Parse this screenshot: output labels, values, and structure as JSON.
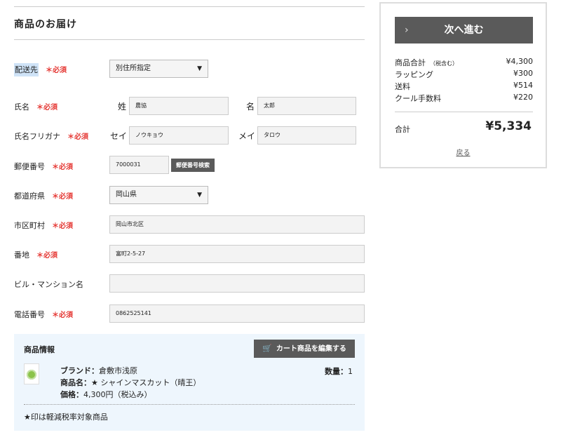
{
  "section": {
    "title": "商品のお届け"
  },
  "form": {
    "delivery": {
      "label": "配送先",
      "required": "＊必須",
      "value": "別住所指定"
    },
    "name": {
      "label": "氏名",
      "required": "＊必須",
      "sei_label": "姓",
      "sei_value": "農協",
      "mei_label": "名",
      "mei_value": "太郎"
    },
    "kana": {
      "label": "氏名フリガナ",
      "required": "＊必須",
      "sei_label": "セイ",
      "sei_value": "ノウキョウ",
      "mei_label": "メイ",
      "mei_value": "タロウ"
    },
    "zip": {
      "label": "郵便番号",
      "required": "＊必須",
      "value": "7000031",
      "button": "郵便番号検索"
    },
    "prefecture": {
      "label": "都道府県",
      "required": "＊必須",
      "value": "岡山県"
    },
    "city": {
      "label": "市区町村",
      "required": "＊必須",
      "value": "岡山市北区"
    },
    "address": {
      "label": "番地",
      "required": "＊必須",
      "value": "富町2-5-27"
    },
    "building": {
      "label": "ビル・マンション名",
      "value": ""
    },
    "phone": {
      "label": "電話番号",
      "required": "＊必須",
      "value": "0862525141"
    }
  },
  "product": {
    "title": "商品情報",
    "edit_button": "カート商品を編集する",
    "brand_label": "ブランド：",
    "brand_value": "倉敷市浅原",
    "name_label": "商品名：",
    "name_value": "★ シャインマスカット（晴王）",
    "price_label": "価格：",
    "price_value": "4,300円（税込み）",
    "qty_label": "数量：",
    "qty_value": "1",
    "note": "★印は軽減税率対象商品"
  },
  "summary": {
    "next_button": "次へ進む",
    "rows": [
      {
        "label": "商品合計",
        "sub": "（税含む）",
        "value": "¥4,300"
      },
      {
        "label": "ラッピング",
        "sub": "",
        "value": "¥300"
      },
      {
        "label": "送料",
        "sub": "",
        "value": "¥514"
      },
      {
        "label": "クール手数料",
        "sub": "",
        "value": "¥220"
      }
    ],
    "total_label": "合計",
    "total_value": "¥5,334",
    "back_link": "戻る"
  }
}
